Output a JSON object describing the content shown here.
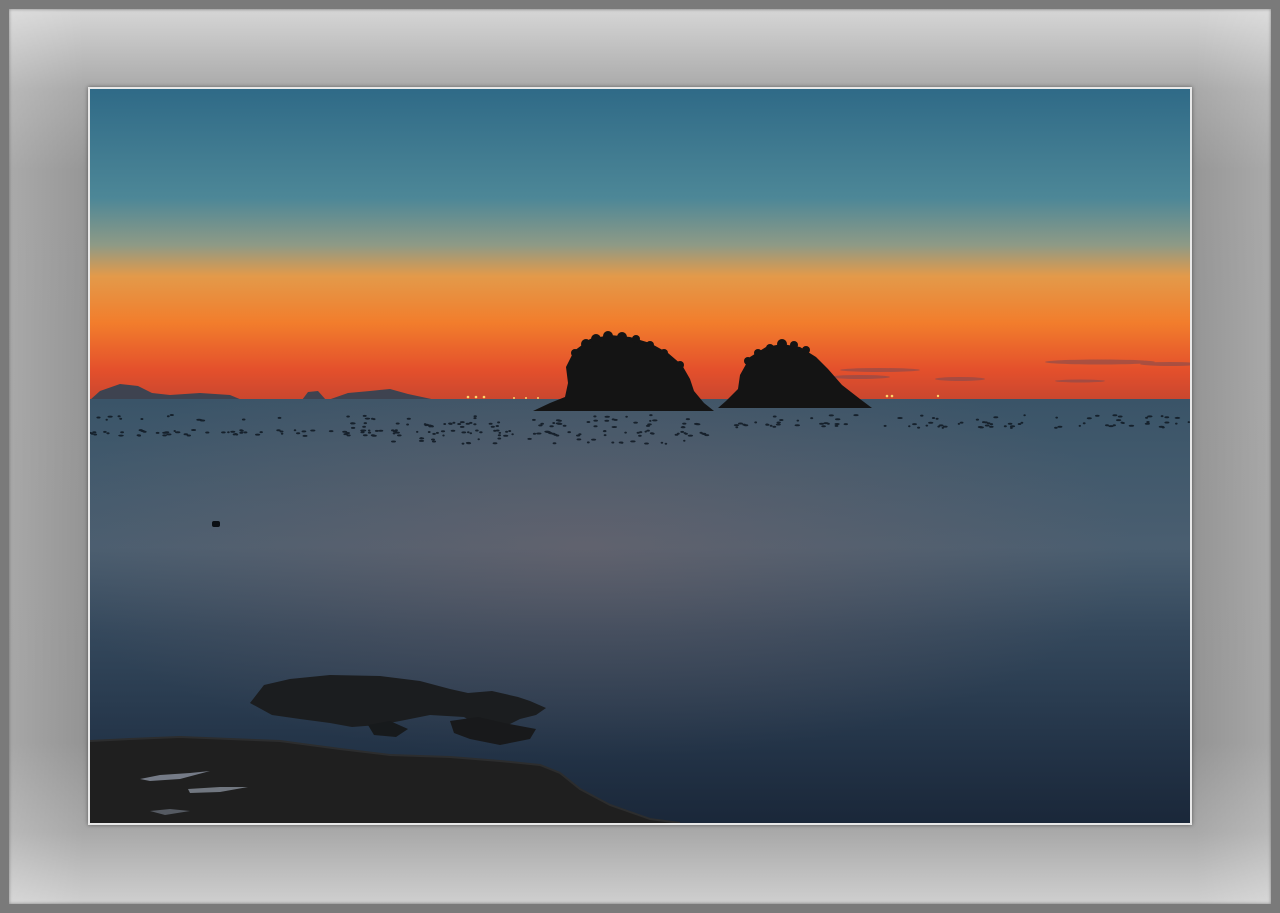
{
  "scene": {
    "description_type": "framed-landscape-photograph",
    "colors": {
      "sky_top": "#2f6b86",
      "sky_mid": "#5a8da0",
      "glow_orange": "#f07a2e",
      "glow_red": "#d8482a",
      "sea_far": "#3f5b70",
      "sea_near": "#1c2a3c",
      "silhouette": "#161616",
      "mat": "#9a9a9a"
    }
  }
}
